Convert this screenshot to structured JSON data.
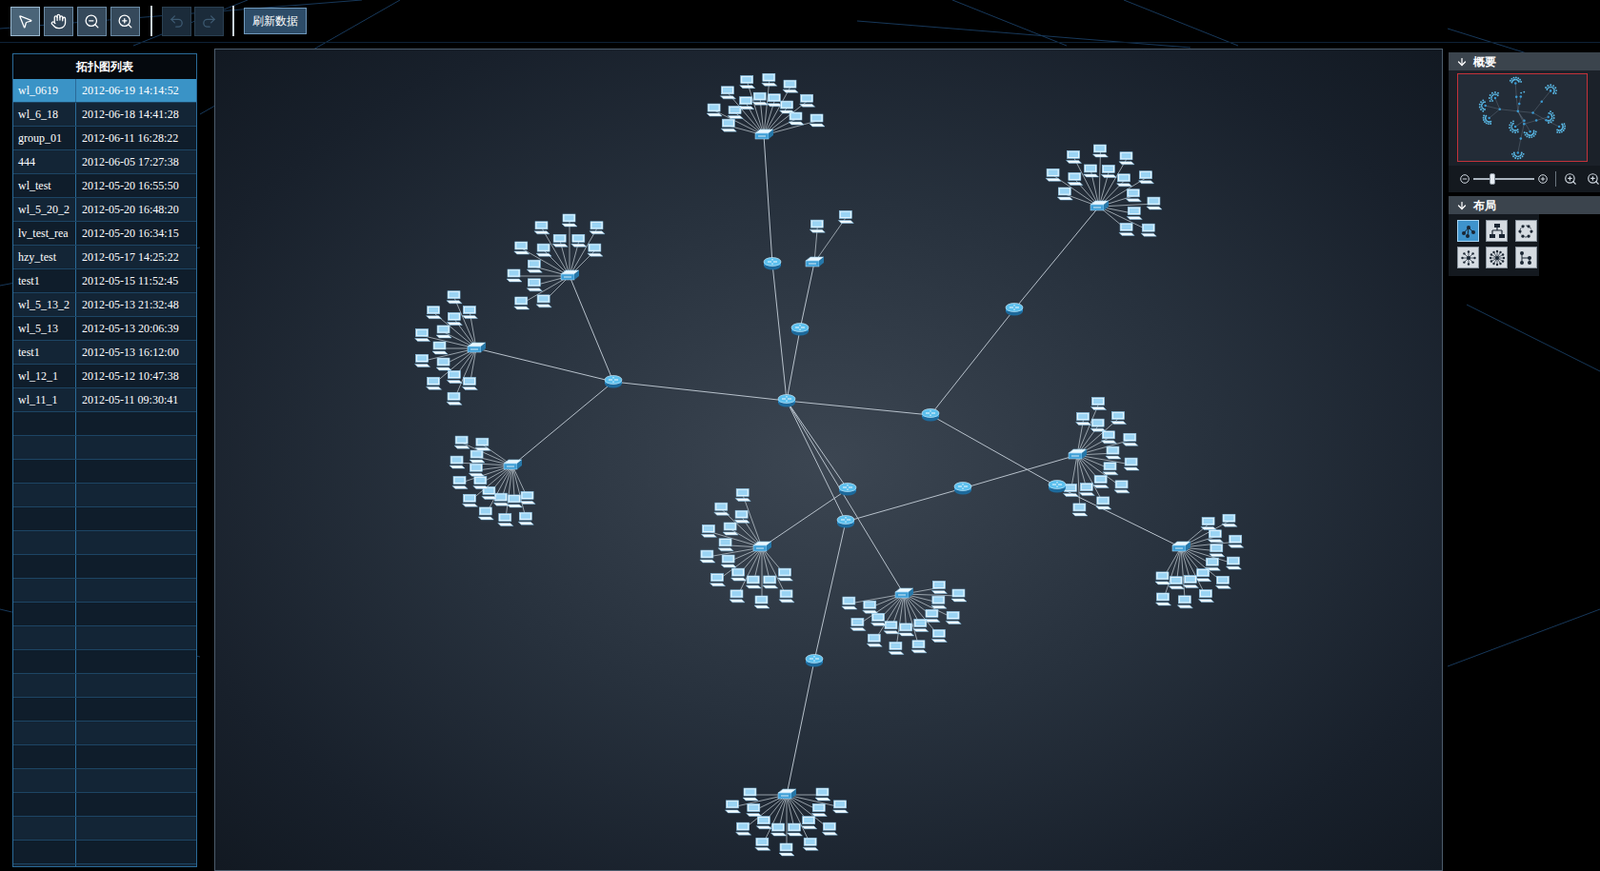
{
  "toolbar": {
    "tools": [
      {
        "kind": "select",
        "selected": true
      },
      {
        "kind": "pan",
        "selected": false
      },
      {
        "kind": "zoom-out",
        "selected": false
      },
      {
        "kind": "zoom-in",
        "selected": false
      }
    ],
    "history": [
      {
        "kind": "undo",
        "disabled": true
      },
      {
        "kind": "redo",
        "disabled": true
      }
    ],
    "refresh_button": "刷新数据"
  },
  "topology_list": {
    "title": "拓扑图列表",
    "rows": [
      {
        "name": "wl_0619",
        "time": "2012-06-19 14:14:52",
        "selected": true
      },
      {
        "name": "wl_6_18",
        "time": "2012-06-18 14:41:28",
        "selected": false
      },
      {
        "name": "group_01",
        "time": "2012-06-11 16:28:22",
        "selected": false
      },
      {
        "name": "444",
        "time": "2012-06-05 17:27:38",
        "selected": false
      },
      {
        "name": "wl_test",
        "time": "2012-05-20 16:55:50",
        "selected": false
      },
      {
        "name": "wl_5_20_2",
        "time": "2012-05-20 16:48:20",
        "selected": false
      },
      {
        "name": "lv_test_rea",
        "time": "2012-05-20 16:34:15",
        "selected": false
      },
      {
        "name": "hzy_test",
        "time": "2012-05-17 14:25:22",
        "selected": false
      },
      {
        "name": "test1",
        "time": "2012-05-15 11:52:45",
        "selected": false
      },
      {
        "name": "wl_5_13_2",
        "time": "2012-05-13 21:32:48",
        "selected": false
      },
      {
        "name": "wl_5_13",
        "time": "2012-05-13 20:06:39",
        "selected": false
      },
      {
        "name": "test1",
        "time": "2012-05-13 16:12:00",
        "selected": false
      },
      {
        "name": "wl_12_1",
        "time": "2012-05-12 10:47:38",
        "selected": false
      },
      {
        "name": "wl_11_1",
        "time": "2012-05-11 09:30:41",
        "selected": false
      }
    ]
  },
  "diagram": {
    "nodes": [
      {
        "kind": "router"
      },
      {
        "kind": "router"
      },
      {
        "kind": "router"
      },
      {
        "kind": "router"
      },
      {
        "kind": "router"
      },
      {
        "kind": "router"
      },
      {
        "kind": "router"
      },
      {
        "kind": "router"
      },
      {
        "kind": "router"
      },
      {
        "kind": "router"
      },
      {
        "kind": "router"
      },
      {
        "kind": "switch",
        "hosts": 14
      },
      {
        "kind": "switch",
        "hosts": 2
      },
      {
        "kind": "switch",
        "hosts": 13
      },
      {
        "kind": "switch",
        "hosts": 13
      },
      {
        "kind": "switch",
        "hosts": 15
      },
      {
        "kind": "switch",
        "hosts": 16
      },
      {
        "kind": "switch",
        "hosts": 16
      },
      {
        "kind": "switch",
        "hosts": 15
      },
      {
        "kind": "switch",
        "hosts": 15
      },
      {
        "kind": "switch",
        "hosts": 15
      },
      {
        "kind": "switch",
        "hosts": 15
      }
    ]
  },
  "overview": {
    "title": "概要"
  },
  "zoom": {
    "level": 0.3
  },
  "layout": {
    "title": "布局",
    "options": [
      {
        "kind": "organic",
        "selected": true
      },
      {
        "kind": "tree",
        "selected": false
      },
      {
        "kind": "circle",
        "selected": false
      },
      {
        "kind": "star",
        "selected": false
      },
      {
        "kind": "radial",
        "selected": false
      },
      {
        "kind": "hierarchy",
        "selected": false
      }
    ]
  }
}
